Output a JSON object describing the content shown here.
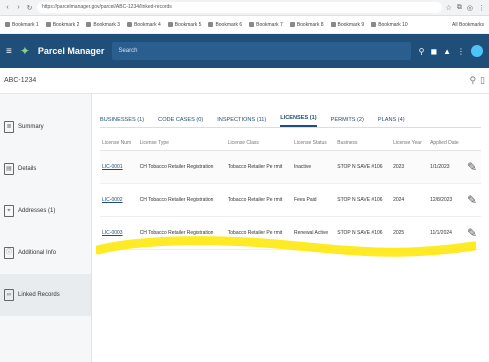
{
  "browser": {
    "url": "https://parcelmanager.gov/parcel/ABC-1234/linked-records",
    "tab_icons": [
      "star-icon",
      "extension-icon",
      "profile-icon",
      "menu-icon"
    ]
  },
  "bookmarks": [
    "Bookmark 1",
    "Bookmark 2",
    "Bookmark 3",
    "Bookmark 4",
    "Bookmark 5",
    "Bookmark 6",
    "Bookmark 7",
    "Bookmark 8",
    "Bookmark 9",
    "Bookmark 10"
  ],
  "bookmarks_all": "All Bookmarks",
  "header": {
    "app_title": "Parcel Manager",
    "search_placeholder": "Search"
  },
  "parcel": {
    "id": "ABC-1234"
  },
  "sidebar": {
    "items": [
      {
        "label": "Summary",
        "icon": "summary-icon"
      },
      {
        "label": "Details",
        "icon": "details-icon"
      },
      {
        "label": "Addresses (1)",
        "icon": "address-icon"
      },
      {
        "label": "Additional Info",
        "icon": "info-icon"
      },
      {
        "label": "Linked Records",
        "icon": "link-icon"
      }
    ]
  },
  "tabs": [
    "BUSINESSES (1)",
    "CODE CASES (0)",
    "INSPECTIONS (11)",
    "LICENSES (1)",
    "PERMITS (2)",
    "PLANS (4)"
  ],
  "active_tab_index": 3,
  "table": {
    "columns": [
      "License Num",
      "License Type",
      "License Class",
      "License Status",
      "Business",
      "License Year",
      "Applied Date"
    ],
    "rows": [
      {
        "num": "LIC-0001",
        "type": "CH Tobacco Retailer Registration",
        "class": "Tobacco Retailer Pe rmit",
        "status": "Inactive",
        "business": "STOP N SAVE #106",
        "year": "2023",
        "date": "1/1/2023"
      },
      {
        "num": "LIC-0002",
        "type": "CH Tobacco Retailer Registration",
        "class": "Tobacco Retailer Pe rmit",
        "status": "Fees Paid",
        "business": "STOP N SAVE #106",
        "year": "2024",
        "date": "12/8/2023"
      },
      {
        "num": "LIC-0003",
        "type": "CH Tobacco Retailer Registration",
        "class": "Tobacco Retailer Pe rmit",
        "status": "Renewal Active",
        "business": "STOP N SAVE #106",
        "year": "2025",
        "date": "11/1/2024"
      }
    ]
  },
  "colors": {
    "header_bg": "#1f4e79",
    "highlighter": "#ffe600"
  }
}
